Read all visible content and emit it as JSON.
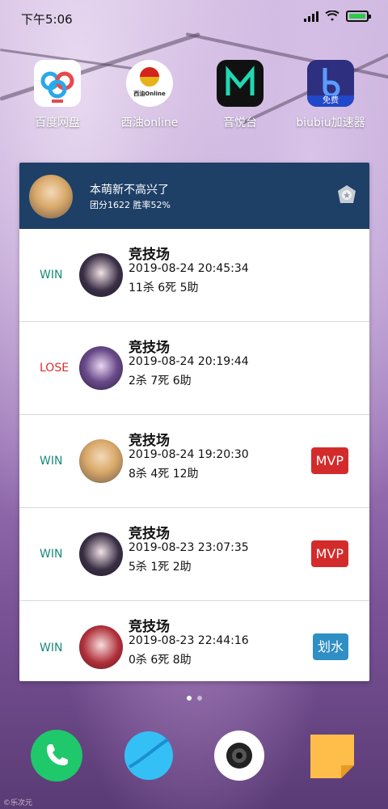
{
  "status_bar": {
    "time": "下午5:06"
  },
  "apps": [
    {
      "label": "百度网盘",
      "icon": "baidu-netdisk-icon"
    },
    {
      "label": "西油online",
      "icon": "xiyou-online-icon",
      "icon_text": "西油Online"
    },
    {
      "label": "音悦台",
      "icon": "yinyuetai-icon"
    },
    {
      "label": "biubiu加速器",
      "icon": "biubiu-accelerator-icon",
      "icon_text": "免费"
    }
  ],
  "widget": {
    "header": {
      "name": "本萌新不高兴了",
      "stats": "团分1622 胜率52%"
    },
    "matches": [
      {
        "result": "WIN",
        "mode": "竞技场",
        "time": "2019-08-24 20:45:34",
        "kda": "11杀 6死 5助",
        "badge": ""
      },
      {
        "result": "LOSE",
        "mode": "竞技场",
        "time": "2019-08-24 20:19:44",
        "kda": "2杀 7死 6助",
        "badge": ""
      },
      {
        "result": "WIN",
        "mode": "竞技场",
        "time": "2019-08-24 19:20:30",
        "kda": "8杀 4死 12助",
        "badge": "MVP"
      },
      {
        "result": "WIN",
        "mode": "竞技场",
        "time": "2019-08-23 23:07:35",
        "kda": "5杀 1死 2助",
        "badge": "MVP"
      },
      {
        "result": "WIN",
        "mode": "竞技场",
        "time": "2019-08-23 22:44:16",
        "kda": "0杀 6死 8助",
        "badge": "划水"
      }
    ]
  },
  "dock": [
    {
      "icon": "phone-icon"
    },
    {
      "icon": "browser-icon"
    },
    {
      "icon": "camera-icon"
    },
    {
      "icon": "notes-icon"
    }
  ],
  "watermark": "©乐次元",
  "colors": {
    "header_bg": "#1e3f66",
    "win": "#1a8a7a",
    "lose": "#d9302a",
    "mvp": "#d32b2b",
    "huashui": "#2f8ec4"
  }
}
